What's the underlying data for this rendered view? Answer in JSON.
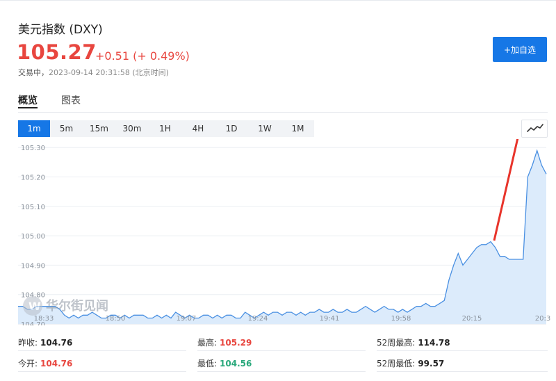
{
  "header": {
    "title": "美元指数 (DXY)",
    "price": "105.27",
    "change": "+0.51 (+ 0.49%)",
    "status_label": "交易中，",
    "timestamp": "2023-09-14 20:31:58 (北京时间)",
    "add_button": "+加自选"
  },
  "tabs": [
    {
      "label": "概览",
      "active": true
    },
    {
      "label": "图表",
      "active": false
    }
  ],
  "periods": [
    "1m",
    "5m",
    "15m",
    "30m",
    "1H",
    "4H",
    "1D",
    "1W",
    "1M"
  ],
  "selected_period": "1m",
  "chart_type_icon": "line-chart-icon",
  "watermark": "华尔街见闻",
  "colors": {
    "accent": "#1677e6",
    "up": "#e8463f",
    "down": "#29a87b",
    "line": "#4a90e2",
    "fill": "#dcebfb",
    "annotation": "#e8342b"
  },
  "chart_data": {
    "type": "area",
    "x_ticks": [
      "18:33",
      "18:50",
      "19:07",
      "19:24",
      "19:41",
      "19:58",
      "20:15",
      "20:3"
    ],
    "y_ticks": [
      "105.30",
      "105.20",
      "105.10",
      "105.00",
      "104.90",
      "104.80",
      "104.70"
    ],
    "ylim": [
      104.7,
      105.31
    ],
    "series": [
      {
        "values": [
          104.76,
          104.76,
          104.75,
          104.75,
          104.76,
          104.76,
          104.76,
          104.76,
          104.76,
          104.75,
          104.73,
          104.72,
          104.73,
          104.72,
          104.73,
          104.73,
          104.74,
          104.73,
          104.72,
          104.72,
          104.73,
          104.73,
          104.72,
          104.73,
          104.72,
          104.73,
          104.73,
          104.73,
          104.72,
          104.72,
          104.73,
          104.72,
          104.73,
          104.72,
          104.74,
          104.73,
          104.72,
          104.73,
          104.72,
          104.72,
          104.73,
          104.73,
          104.72,
          104.73,
          104.72,
          104.73,
          104.73,
          104.72,
          104.72,
          104.74,
          104.73,
          104.72,
          104.73,
          104.74,
          104.73,
          104.74,
          104.74,
          104.73,
          104.74,
          104.74,
          104.73,
          104.74,
          104.73,
          104.74,
          104.74,
          104.75,
          104.74,
          104.74,
          104.75,
          104.74,
          104.74,
          104.75,
          104.74,
          104.74,
          104.75,
          104.76,
          104.75,
          104.74,
          104.75,
          104.76,
          104.75,
          104.75,
          104.74,
          104.75,
          104.74,
          104.75,
          104.76,
          104.76,
          104.77,
          104.76,
          104.76,
          104.77,
          104.78,
          104.85,
          104.9,
          104.94,
          104.9,
          104.92,
          104.94,
          104.96,
          104.97,
          104.97,
          104.98,
          104.96,
          104.93,
          104.93,
          104.92,
          104.92,
          104.92,
          104.92,
          105.2,
          105.24,
          105.29,
          105.24,
          105.21
        ]
      }
    ],
    "annotation": "red arrow pointing to chart-type toggle"
  },
  "stats": {
    "row1": [
      {
        "label": "昨收:",
        "value": "104.76",
        "color": "neutral"
      },
      {
        "label": "最高:",
        "value": "105.29",
        "color": "up"
      },
      {
        "label": "52周最高:",
        "value": "114.78",
        "color": "neutral"
      }
    ],
    "row2": [
      {
        "label": "今开:",
        "value": "104.76",
        "color": "up"
      },
      {
        "label": "最低:",
        "value": "104.56",
        "color": "down"
      },
      {
        "label": "52周最低:",
        "value": "99.57",
        "color": "neutral"
      }
    ]
  }
}
